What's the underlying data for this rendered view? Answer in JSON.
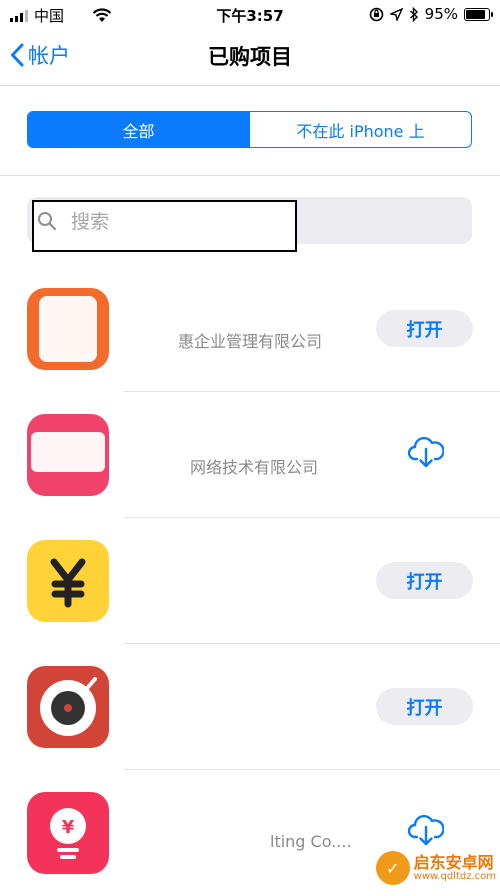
{
  "status_bar": {
    "carrier": "中国",
    "time": "下午3:57",
    "battery": "95%",
    "battery_level": 0.95
  },
  "nav": {
    "back_label": "帐户",
    "title": "已购项目"
  },
  "segments": {
    "all": "全部",
    "not_on_device": "不在此 iPhone 上",
    "selected": "全部"
  },
  "search": {
    "placeholder": "搜索",
    "value": ""
  },
  "apps": [
    {
      "subtitle": "惠企业管理有限公司",
      "action": "打开",
      "action_type": "open",
      "icon_color": "#f26a2c"
    },
    {
      "subtitle": "网络技术有限公司",
      "action": "",
      "action_type": "download",
      "icon_color": "#f0436b"
    },
    {
      "subtitle": "",
      "action": "打开",
      "action_type": "open",
      "icon_color": "#ffd338"
    },
    {
      "subtitle": "",
      "action": "打开",
      "action_type": "open",
      "icon_color": "#d24437"
    },
    {
      "subtitle": "lting Co....",
      "action": "",
      "action_type": "download",
      "icon_color": "#f4335a"
    }
  ],
  "watermark": {
    "line1": "启东安卓网",
    "line2": "www.qdltdz.com"
  }
}
